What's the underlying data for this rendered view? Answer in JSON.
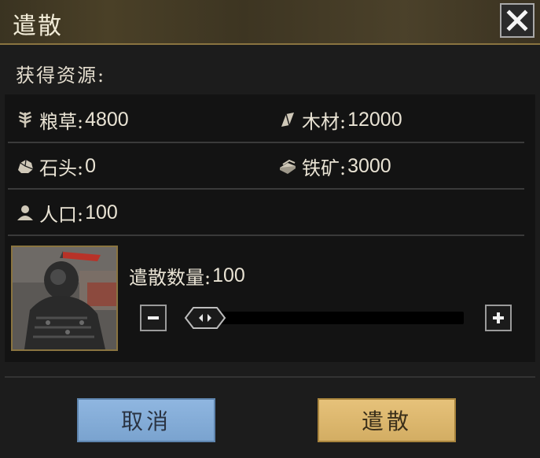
{
  "dialog": {
    "title": "遣散",
    "close_icon": "close-icon"
  },
  "resources": {
    "section_label": "获得资源:",
    "items": [
      {
        "label": "粮草:",
        "value": "4800",
        "icon": "wheat-icon"
      },
      {
        "label": "木材:",
        "value": "12000",
        "icon": "wood-icon"
      },
      {
        "label": "石头:",
        "value": "0",
        "icon": "stone-icon"
      },
      {
        "label": "铁矿:",
        "value": "3000",
        "icon": "iron-icon"
      },
      {
        "label": "人口:",
        "value": "100",
        "icon": "population-icon"
      }
    ]
  },
  "dismiss": {
    "amount_label": "遣散数量:",
    "amount_value": "100",
    "slider_fraction": 0.0
  },
  "buttons": {
    "cancel": "取消",
    "confirm": "遣散"
  },
  "colors": {
    "cancel_button": "#8fb6e0",
    "confirm_button": "#e6c27a",
    "accent_border": "#8a7440"
  }
}
